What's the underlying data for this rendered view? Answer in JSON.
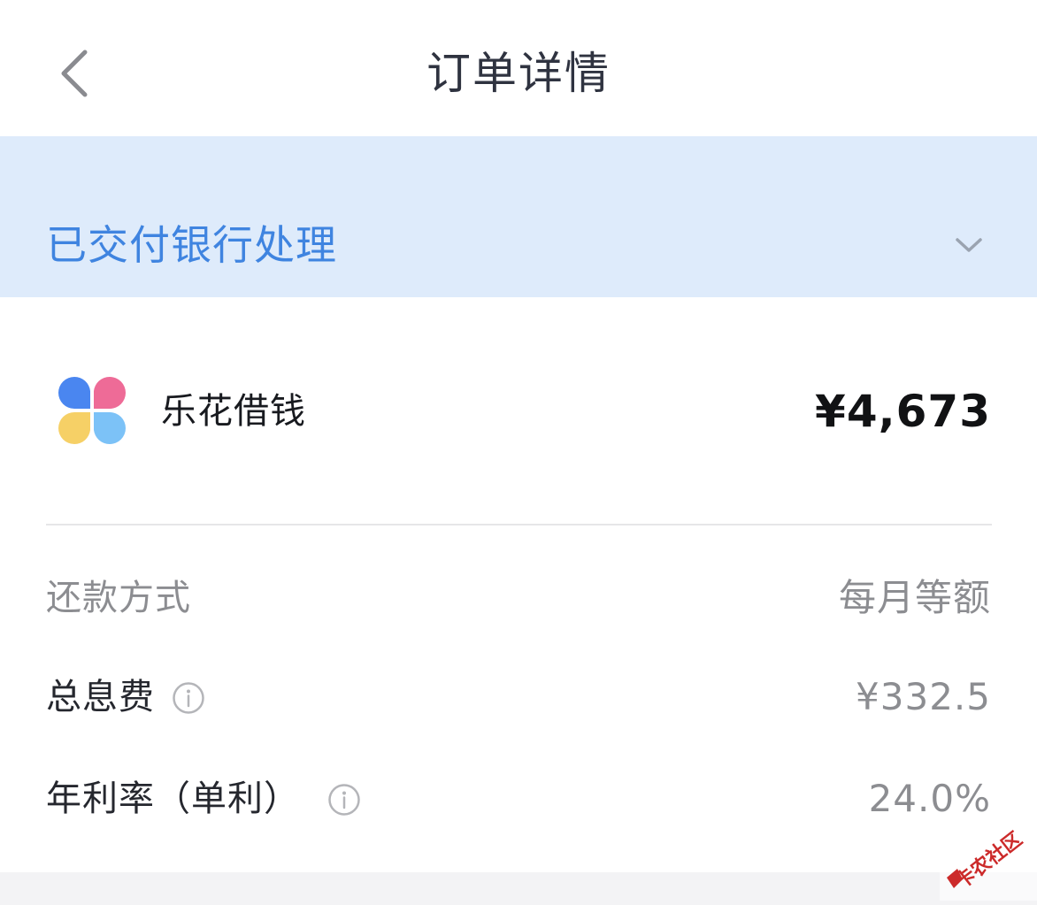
{
  "header": {
    "title": "订单详情",
    "back_icon": "chevron-left-icon"
  },
  "status": {
    "text": "已交付银行处理",
    "expand_icon": "chevron-down-icon",
    "text_color": "#3f84e0",
    "background": "#deebfb"
  },
  "product": {
    "name": "乐花借钱",
    "amount": "¥4,673",
    "logo_colors": [
      "#4a86f0",
      "#ee6b97",
      "#f6d066",
      "#7cc2f7"
    ]
  },
  "details": {
    "repayment_method": {
      "label": "还款方式",
      "value": "每月等额"
    },
    "total_interest": {
      "label": "总息费",
      "value": "¥332.5",
      "icon": "info-icon"
    },
    "annual_rate": {
      "label": "年利率（单利）",
      "value": "24.0%",
      "icon": "info-icon"
    }
  },
  "watermark": {
    "text": "卡农社区"
  }
}
